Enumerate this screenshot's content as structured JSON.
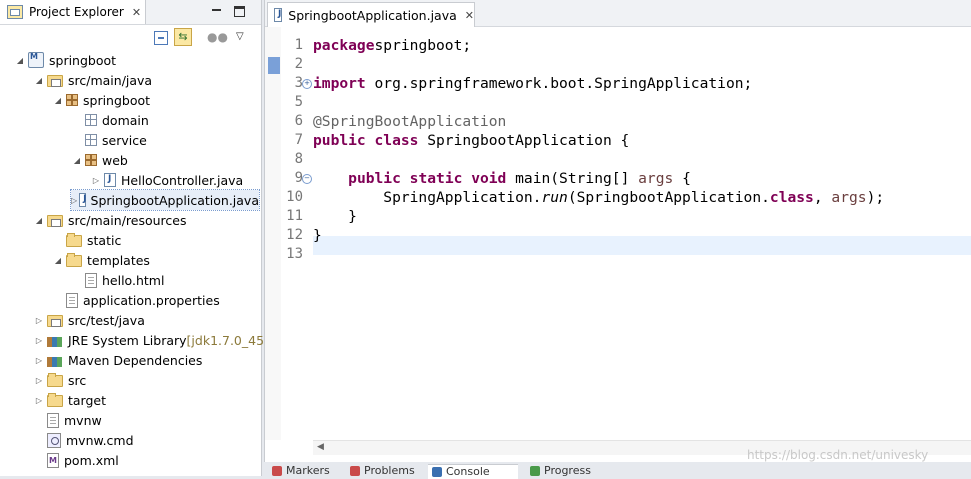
{
  "project_explorer": {
    "tab_label": "Project Explorer",
    "tree": [
      {
        "label": "springboot",
        "depth": 0,
        "twisty": "open",
        "icon": "project-icon"
      },
      {
        "label": "src/main/java",
        "depth": 1,
        "twisty": "open",
        "icon": "source-folder-icon"
      },
      {
        "label": "springboot",
        "depth": 2,
        "twisty": "open",
        "icon": "package-icon"
      },
      {
        "label": "domain",
        "depth": 3,
        "twisty": "none",
        "icon": "empty-package-icon"
      },
      {
        "label": "service",
        "depth": 3,
        "twisty": "none",
        "icon": "empty-package-icon"
      },
      {
        "label": "web",
        "depth": 3,
        "twisty": "open",
        "icon": "package-icon"
      },
      {
        "label": "HelloController.java",
        "depth": 4,
        "twisty": "closed",
        "icon": "java-file-icon"
      },
      {
        "label": "SpringbootApplication.java",
        "depth": 3,
        "twisty": "closed",
        "icon": "java-file-icon",
        "selected": true
      },
      {
        "label": "src/main/resources",
        "depth": 1,
        "twisty": "open",
        "icon": "source-folder-icon"
      },
      {
        "label": "static",
        "depth": 2,
        "twisty": "none",
        "icon": "folder-icon"
      },
      {
        "label": "templates",
        "depth": 2,
        "twisty": "open",
        "icon": "folder-icon"
      },
      {
        "label": "hello.html",
        "depth": 3,
        "twisty": "none",
        "icon": "file-icon"
      },
      {
        "label": "application.properties",
        "depth": 2,
        "twisty": "none",
        "icon": "file-icon"
      },
      {
        "label": "src/test/java",
        "depth": 1,
        "twisty": "closed",
        "icon": "source-folder-icon"
      },
      {
        "label": "JRE System Library",
        "suffix": "[jdk1.7.0_45]",
        "depth": 1,
        "twisty": "closed",
        "icon": "library-icon"
      },
      {
        "label": "Maven Dependencies",
        "depth": 1,
        "twisty": "closed",
        "icon": "library-icon"
      },
      {
        "label": "src",
        "depth": 1,
        "twisty": "closed",
        "icon": "folder-icon"
      },
      {
        "label": "target",
        "depth": 1,
        "twisty": "closed",
        "icon": "folder-icon"
      },
      {
        "label": "mvnw",
        "depth": 1,
        "twisty": "none",
        "icon": "file-icon"
      },
      {
        "label": "mvnw.cmd",
        "depth": 1,
        "twisty": "none",
        "icon": "cmd-file-icon"
      },
      {
        "label": "pom.xml",
        "depth": 1,
        "twisty": "none",
        "icon": "maven-xml-icon"
      }
    ]
  },
  "editor": {
    "tab_label": "SpringbootApplication.java",
    "line_numbers": [
      "1",
      "2",
      "3",
      "5",
      "6",
      "7",
      "8",
      "9",
      "10",
      "11",
      "12",
      "13"
    ],
    "lines": [
      {
        "n": "1",
        "segs": [
          [
            "kw",
            "package"
          ],
          [
            "",
            "springboot;"
          ]
        ]
      },
      {
        "n": "2",
        "segs": []
      },
      {
        "n": "3",
        "fold": "+",
        "segs": [
          [
            "kw",
            "import"
          ],
          [
            "",
            " org.springframework.boot.SpringApplication;"
          ]
        ]
      },
      {
        "n": "5",
        "segs": []
      },
      {
        "n": "6",
        "segs": [
          [
            "an",
            "@SpringBootApplication"
          ]
        ]
      },
      {
        "n": "7",
        "segs": [
          [
            "kw",
            "public"
          ],
          [
            "",
            " "
          ],
          [
            "kw",
            "class"
          ],
          [
            "",
            " SpringbootApplication {"
          ]
        ]
      },
      {
        "n": "8",
        "segs": []
      },
      {
        "n": "9",
        "fold": "-",
        "segs": [
          [
            "",
            "    "
          ],
          [
            "kw",
            "public"
          ],
          [
            "",
            " "
          ],
          [
            "kw",
            "static"
          ],
          [
            "",
            " "
          ],
          [
            "kw",
            "void"
          ],
          [
            "",
            " main(String[] "
          ],
          [
            "ar",
            "args"
          ],
          [
            "",
            " {"
          ]
        ]
      },
      {
        "n": "10",
        "segs": [
          [
            "",
            "        SpringApplication."
          ],
          [
            "it",
            "run"
          ],
          [
            "",
            "(SpringbootApplication."
          ],
          [
            "kw",
            "class"
          ],
          [
            "",
            ", "
          ],
          [
            "ar",
            "args"
          ],
          [
            "",
            ");"
          ]
        ]
      },
      {
        "n": "11",
        "segs": [
          [
            "",
            "    }"
          ]
        ]
      },
      {
        "n": "12",
        "segs": [
          [
            "",
            "}"
          ]
        ]
      },
      {
        "n": "13",
        "segs": []
      }
    ]
  },
  "bottom_tabs": [
    {
      "label": "Markers",
      "color": "#c94a4a"
    },
    {
      "label": "Problems",
      "color": "#c94a4a"
    },
    {
      "label": "Console",
      "color": "#3a6fb0"
    },
    {
      "label": "Progress",
      "color": "#4a9a4a"
    }
  ],
  "watermark": "https://blog.csdn.net/univesky"
}
